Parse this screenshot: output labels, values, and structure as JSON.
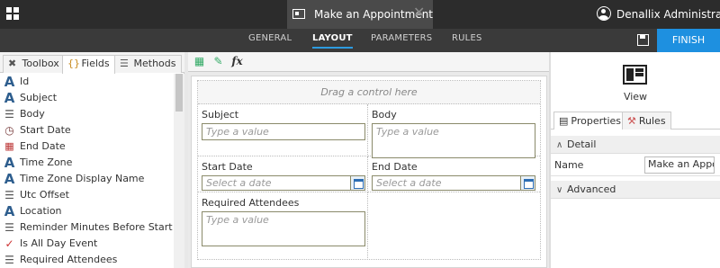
{
  "topbar": {
    "doc_title": "Make an Appointment",
    "user_name": "Denallix Administrator",
    "close_glyph": "✕"
  },
  "subnav": {
    "tabs": [
      "GENERAL",
      "LAYOUT",
      "PARAMETERS",
      "RULES"
    ],
    "active_tab": "LAYOUT",
    "finish_label": "FINISH",
    "accent": "#1e90e0"
  },
  "left_panel": {
    "tabs": [
      "Toolbox",
      "Fields",
      "Methods"
    ],
    "active_tab": "Fields",
    "fields": [
      {
        "label": "Id",
        "icon": "text-a-icon"
      },
      {
        "label": "Subject",
        "icon": "text-a-icon"
      },
      {
        "label": "Body",
        "icon": "multiline-icon"
      },
      {
        "label": "Start Date",
        "icon": "datetime-icon"
      },
      {
        "label": "End Date",
        "icon": "datetime-icon"
      },
      {
        "label": "Time Zone",
        "icon": "text-a-icon"
      },
      {
        "label": "Time Zone Display Name",
        "icon": "text-a-icon"
      },
      {
        "label": "Utc Offset",
        "icon": "number-icon"
      },
      {
        "label": "Location",
        "icon": "text-a-icon"
      },
      {
        "label": "Reminder Minutes Before Start",
        "icon": "number-icon"
      },
      {
        "label": "Is All Day Event",
        "icon": "boolean-icon"
      },
      {
        "label": "Required Attendees",
        "icon": "multiline-icon"
      }
    ]
  },
  "canvas": {
    "toolbar": {
      "fx_label": "fx"
    },
    "drag_hint": "Drag a control here",
    "fields": {
      "subject": {
        "label": "Subject",
        "placeholder": "Type a value"
      },
      "body": {
        "label": "Body",
        "placeholder": "Type a value"
      },
      "start_date": {
        "label": "Start Date",
        "placeholder": "Select a date"
      },
      "end_date": {
        "label": "End Date",
        "placeholder": "Select a date"
      },
      "required_attendees": {
        "label": "Required Attendees",
        "placeholder": "Type a value"
      }
    }
  },
  "right_panel": {
    "view_label": "View",
    "tabs": [
      "Properties",
      "Rules"
    ],
    "active_tab": "Properties",
    "sections": {
      "detail": "Detail",
      "advanced": "Advanced"
    },
    "properties": [
      {
        "name": "Name",
        "value": "Make an Appointment"
      }
    ]
  }
}
